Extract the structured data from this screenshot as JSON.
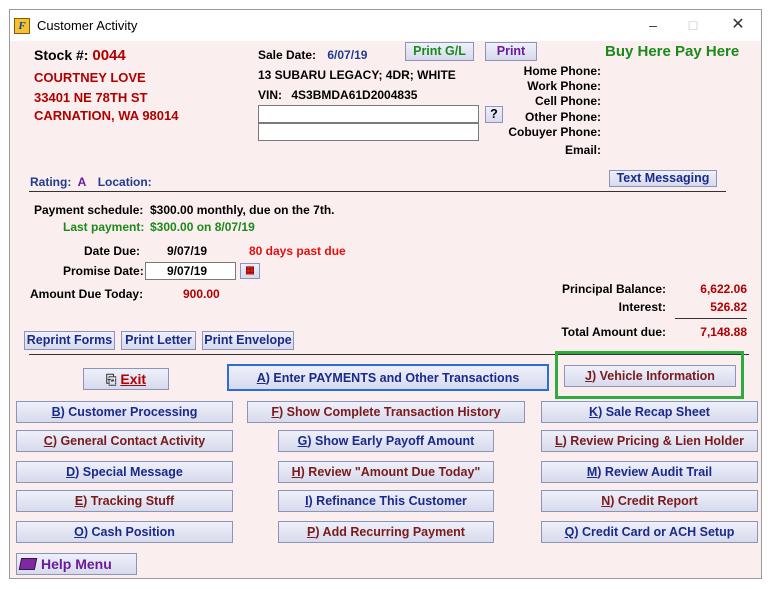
{
  "window": {
    "title": "Customer Activity",
    "app_icon": "app-icon"
  },
  "stock": {
    "label": "Stock #:",
    "value": "0044"
  },
  "customer": {
    "name": "COURTNEY LOVE",
    "street": "33401 NE 78TH ST",
    "city": "CARNATION, WA 98014"
  },
  "sale": {
    "label": "Sale Date:",
    "value": "6/07/19",
    "vehicle": "13 SUBARU LEGACY; 4DR; WHITE",
    "vin_label": "VIN:",
    "vin": "4S3BMDA61D2004835"
  },
  "top_buttons": {
    "print_gl": "Print G/L",
    "print": "Print",
    "question": "?"
  },
  "brand": "Buy Here Pay Here",
  "phones": {
    "home": "Home Phone:",
    "work": "Work Phone:",
    "cell": "Cell Phone:",
    "other": "Other Phone:",
    "cobuyer": "Cobuyer Phone:",
    "email": "Email:"
  },
  "rating": {
    "label": "Rating:",
    "value": "A",
    "location_label": "Location:"
  },
  "text_messaging": "Text Messaging",
  "schedule": {
    "label": "Payment schedule:",
    "value": "$300.00 monthly, due on the 7th.",
    "last_label": "Last payment:",
    "last_value": "$300.00 on  8/07/19"
  },
  "due": {
    "date_label": "Date Due:",
    "date_value": "9/07/19",
    "past_due": "80 days past due",
    "promise_label": "Promise Date:",
    "promise_value": "9/07/19",
    "amount_label": "Amount Due Today:",
    "amount_value": "900.00"
  },
  "balance": {
    "principal_label": "Principal Balance:",
    "principal_value": "6,622.06",
    "interest_label": "Interest:",
    "interest_value": "526.82",
    "total_label": "Total Amount due:",
    "total_value": "7,148.88"
  },
  "print_buttons": {
    "reprint": "Reprint Forms",
    "letter": "Print Letter",
    "envelope": "Print Envelope"
  },
  "actions": {
    "exit": {
      "key": "E",
      "rest": "xit"
    },
    "enter_payments": {
      "key": "A",
      "rest": ") Enter PAYMENTS and Other Transactions"
    },
    "vehicle_info": {
      "key": "J",
      "rest": ") Vehicle Information"
    },
    "customer_processing": {
      "key": "B",
      "rest": ") Customer Processing"
    },
    "transaction_history": {
      "key": "F",
      "rest": ") Show Complete Transaction History"
    },
    "sale_recap": {
      "key": "K",
      "rest": ") Sale Recap Sheet"
    },
    "general_contact": {
      "key": "C",
      "rest": ") General Contact Activity"
    },
    "early_payoff": {
      "key": "G",
      "rest": ") Show Early Payoff Amount"
    },
    "review_pricing": {
      "key": "L",
      "rest": ") Review Pricing & Lien Holder"
    },
    "special_message": {
      "key": "D",
      "rest": ") Special Message"
    },
    "review_amount_due": {
      "key": "H",
      "rest": ") Review \"Amount Due Today\""
    },
    "review_audit": {
      "key": "M",
      "rest": ") Review Audit Trail"
    },
    "tracking": {
      "key": "E",
      "rest": ") Tracking Stuff"
    },
    "refinance": {
      "key": "I",
      "rest": ") Refinance This Customer"
    },
    "credit_report": {
      "key": "N",
      "rest": ") Credit Report"
    },
    "cash_position": {
      "key": "O",
      "rest": ") Cash Position"
    },
    "recurring_payment": {
      "key": "P",
      "rest": ") Add Recurring Payment"
    },
    "credit_card": {
      "key": "Q",
      "rest": ") Credit Card or ACH Setup"
    }
  },
  "help_menu": "Help Menu",
  "colors": {
    "highlight": "#2faa3e",
    "focus": "#2b6fd6",
    "background": "#fbeeee"
  }
}
